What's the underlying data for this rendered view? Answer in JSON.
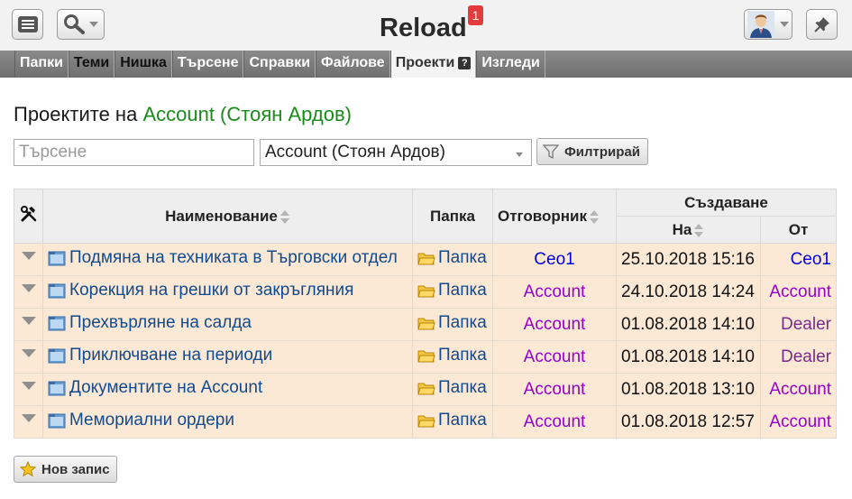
{
  "header": {
    "title": "Reload",
    "notification_count": "1"
  },
  "nav": {
    "tabs": [
      {
        "label": "Папки"
      },
      {
        "label": "Теми"
      },
      {
        "label": "Нишка"
      },
      {
        "label": "Търсене"
      },
      {
        "label": "Справки"
      },
      {
        "label": "Файлове"
      },
      {
        "label": "Проекти",
        "help": "?"
      },
      {
        "label": "Изгледи"
      }
    ],
    "active_tab": "Проекти"
  },
  "page": {
    "title_prefix": "Проектите на",
    "owner": "Account (Стоян Ардов)"
  },
  "filter": {
    "search_placeholder": "Търсене",
    "search_value": "",
    "selected_owner": "Account (Стоян Ардов)",
    "filter_label": "Филтрирай"
  },
  "table": {
    "headers": {
      "name": "Наименование",
      "folder": "Папка",
      "responsible": "Отговорник",
      "created": "Създаване",
      "created_on": "На",
      "created_by": "От"
    },
    "rows": [
      {
        "name": "Подмяна на техниката в Търговски отдел",
        "folder": "Папка",
        "responsible": "Ceo1",
        "created_on": "25.10.2018 15:16",
        "created_by": "Ceo1"
      },
      {
        "name": "Корекция на грешки от закръгляния",
        "folder": "Папка",
        "responsible": "Account",
        "created_on": "24.10.2018 14:24",
        "created_by": "Account"
      },
      {
        "name": "Прехвърляне на салда",
        "folder": "Папка",
        "responsible": "Account",
        "created_on": "01.08.2018 14:10",
        "created_by": "Dealer"
      },
      {
        "name": "Приключване на периоди",
        "folder": "Папка",
        "responsible": "Account",
        "created_on": "01.08.2018 14:10",
        "created_by": "Dealer"
      },
      {
        "name": "Документите на Account",
        "folder": "Папка",
        "responsible": "Account",
        "created_on": "01.08.2018 13:10",
        "created_by": "Account"
      },
      {
        "name": "Мемориални ордери",
        "folder": "Папка",
        "responsible": "Account",
        "created_on": "01.08.2018 12:57",
        "created_by": "Account"
      }
    ]
  },
  "actions": {
    "new_record_label": "Нов запис"
  },
  "colors": {
    "row_background": "#fbe9d6",
    "owner_green": "#1a8a1a",
    "link_blue": "#134a8e",
    "user_purple": "#9900cc",
    "badge_red": "#e23c3c"
  }
}
